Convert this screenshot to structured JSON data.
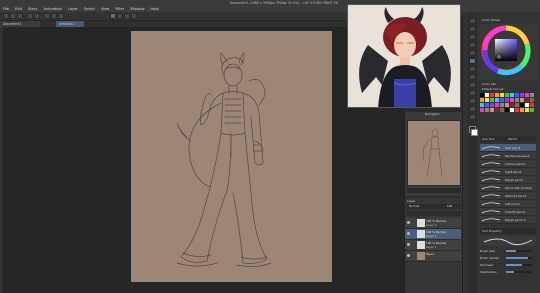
{
  "app": {
    "title": "Document1 (2480 x 3508px 350dpi 25.0%) - CLIP STUDIO PAINT EX"
  },
  "menu": [
    "File",
    "Edit",
    "Story",
    "Animation",
    "Layer",
    "Select",
    "View",
    "Filter",
    "Window",
    "Help"
  ],
  "tabs": [
    "Document1",
    "Untitled-1"
  ],
  "reference_window": {
    "label": "Sub View"
  },
  "navigator": {
    "header": "Navigator"
  },
  "layers": {
    "header": "Layer",
    "blend_mode": "Normal",
    "opacity": "100",
    "items": [
      {
        "name": "100 % Normal",
        "sub": "Layer 3",
        "selected": false
      },
      {
        "name": "100 % Normal",
        "sub": "Layer 2",
        "selected": true
      },
      {
        "name": "100 % Normal",
        "sub": "Layer 1",
        "selected": false
      },
      {
        "name": "Paper",
        "sub": "",
        "selected": false
      }
    ]
  },
  "color_panel": {
    "header": "Color Wheel",
    "hue_color": "#6a5cff",
    "fg_color": "#222222",
    "bg_color": "#ffffff"
  },
  "color_set": {
    "header": "Color Set",
    "label": "Default color set"
  },
  "sub_tool": {
    "header": "Sub Tool",
    "group": "Pencil",
    "items": [
      "Real pencil",
      "Mechanical pencil",
      "Colored pencil",
      "Light pencil",
      "Rough pencil",
      "Pencil with shading",
      "Textured pencil",
      "Soft pencil",
      "Smooth pencil",
      "Rough pencil 2"
    ]
  },
  "tool_property": {
    "header": "Tool Property",
    "items": [
      {
        "label": "Brush Size",
        "value": "8.0"
      },
      {
        "label": "Brush density",
        "value": "85"
      },
      {
        "label": "Hardness",
        "value": ""
      },
      {
        "label": "Stabilization",
        "value": "6"
      }
    ]
  }
}
